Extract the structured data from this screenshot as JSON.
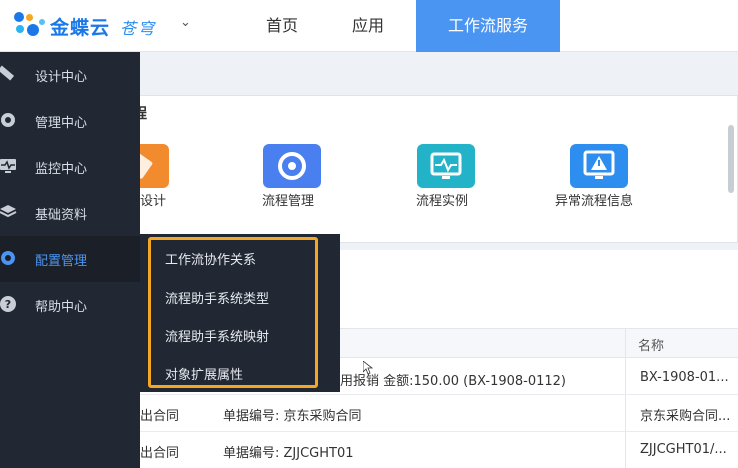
{
  "header": {
    "brand": "金蝶云",
    "brand_sub": "苍穹",
    "nav": [
      "首页",
      "应用",
      "工作流服务"
    ],
    "active_nav": "工作流服务"
  },
  "sidebar": {
    "items": [
      {
        "label": "设计中心",
        "icon": "design-icon"
      },
      {
        "label": "管理中心",
        "icon": "target-icon"
      },
      {
        "label": "监控中心",
        "icon": "monitor-icon"
      },
      {
        "label": "基础资料",
        "icon": "layers-icon"
      },
      {
        "label": "配置管理",
        "icon": "gear-icon"
      },
      {
        "label": "帮助中心",
        "icon": "help-icon"
      }
    ],
    "active": "配置管理"
  },
  "flyout": {
    "items": [
      "工作流协作关系",
      "流程助手系统类型",
      "流程助手系统映射",
      "对象扩展属性"
    ]
  },
  "main": {
    "panel_title_fragment": "程",
    "tiles": [
      {
        "label": "设计",
        "color": "#f28a2e"
      },
      {
        "label": "流程管理",
        "color": "#4a7ff0"
      },
      {
        "label": "流程实例",
        "color": "#22b3c8"
      },
      {
        "label": "异常流程信息",
        "color": "#2d8ef0"
      }
    ],
    "table": {
      "name_header": "名称",
      "rows": [
        {
          "c1": "",
          "c2": "用报销 金额:150.00 (BX-1908-0112)",
          "name": "BX-1908-01..."
        },
        {
          "c1": "出合同",
          "c2": "单据编号: 京东采购合同",
          "name": "京东采购合同..."
        },
        {
          "c1": "出合同",
          "c2": "单据编号: ZJJCGHT01",
          "name": "ZJJCGHT01/..."
        }
      ]
    }
  },
  "colors": {
    "sidebar_bg": "#222833",
    "active_nav": "#4b95f2",
    "highlight": "#f5a623"
  }
}
